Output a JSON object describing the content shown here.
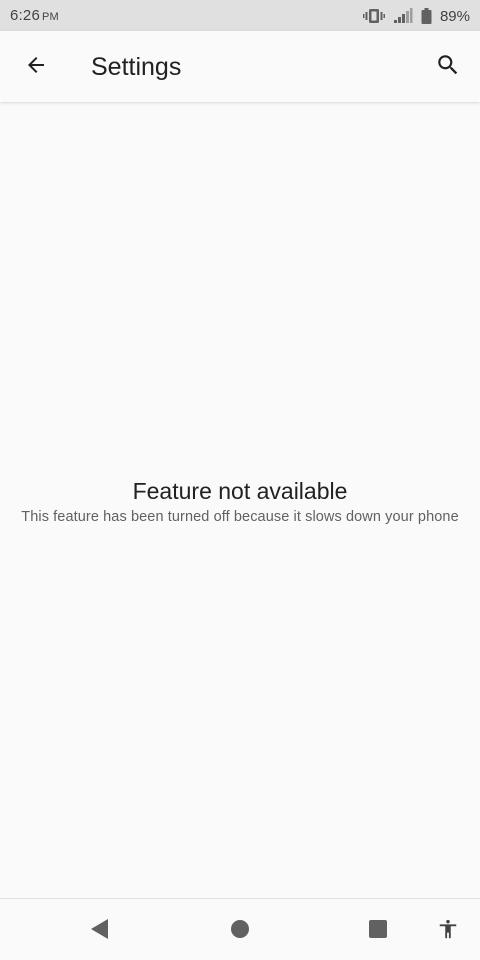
{
  "status_bar": {
    "time": "6:26",
    "ampm": "PM",
    "battery_percent": "89%",
    "icons": [
      "vibrate-icon",
      "signal-icon",
      "battery-icon"
    ]
  },
  "app_bar": {
    "title": "Settings",
    "back_icon": "arrow-back-icon",
    "search_icon": "search-icon"
  },
  "content": {
    "title": "Feature not available",
    "body": "This feature has been turned off because it slows down your phone"
  },
  "nav_bar": {
    "buttons": [
      "back-triangle-icon",
      "home-circle-icon",
      "recents-square-icon",
      "accessibility-icon"
    ]
  },
  "colors": {
    "status_bar_bg": "#e0e0e0",
    "background": "#fafafa",
    "text_primary": "#212121",
    "text_secondary": "#616161",
    "nav_icon": "#616161"
  }
}
